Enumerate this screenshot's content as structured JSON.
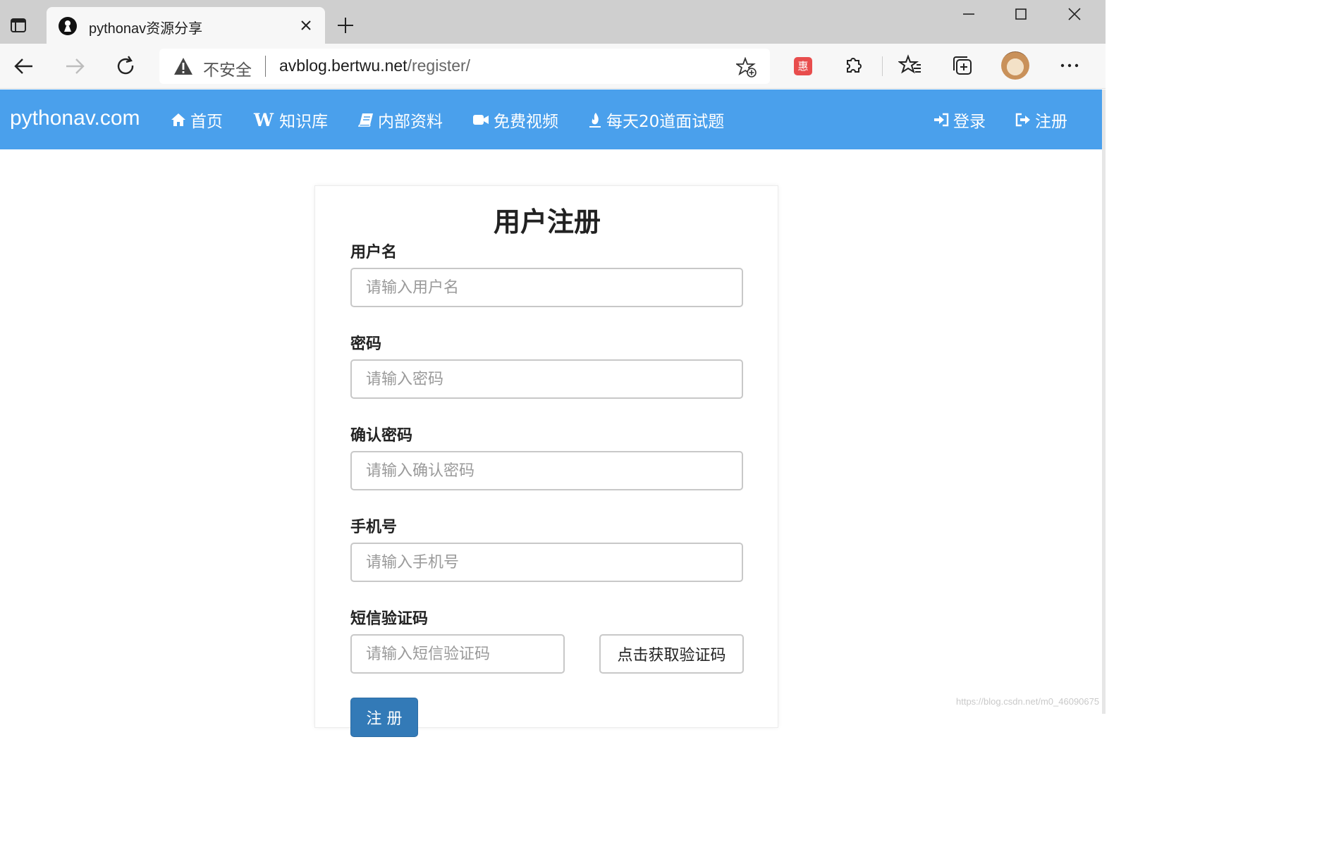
{
  "browser": {
    "tab_title": "pythonav资源分享",
    "address": {
      "security_label": "不安全",
      "host": "avblog.bertwu.net",
      "path": "/register/"
    },
    "coupon_badge": "惠"
  },
  "navbar": {
    "brand": "pythonav.com",
    "items": [
      {
        "label": "首页",
        "icon": "home-icon"
      },
      {
        "label": "知识库",
        "icon": "wikipedia-w-icon",
        "glyph": "W"
      },
      {
        "label": "内部资料",
        "icon": "book-icon"
      },
      {
        "label": "免费视频",
        "icon": "video-camera-icon"
      },
      {
        "label": "每天20道面试题",
        "icon": "fire-icon"
      }
    ],
    "right_items": [
      {
        "label": "登录",
        "icon": "sign-in-icon"
      },
      {
        "label": "注册",
        "icon": "sign-up-icon"
      }
    ]
  },
  "form": {
    "title": "用户注册",
    "fields": [
      {
        "label": "用户名",
        "placeholder": "请输入用户名",
        "value": ""
      },
      {
        "label": "密码",
        "placeholder": "请输入密码",
        "value": ""
      },
      {
        "label": "确认密码",
        "placeholder": "请输入确认密码",
        "value": ""
      },
      {
        "label": "手机号",
        "placeholder": "请输入手机号",
        "value": ""
      },
      {
        "label": "短信验证码",
        "placeholder": "请输入短信验证码",
        "value": ""
      }
    ],
    "sms_button": "点击获取验证码",
    "submit": "注 册"
  },
  "watermark": "https://blog.csdn.net/m0_46090675",
  "colors": {
    "navbar": "#4aa0ec",
    "submit": "#337ab7",
    "coupon": "#e84d4d"
  }
}
